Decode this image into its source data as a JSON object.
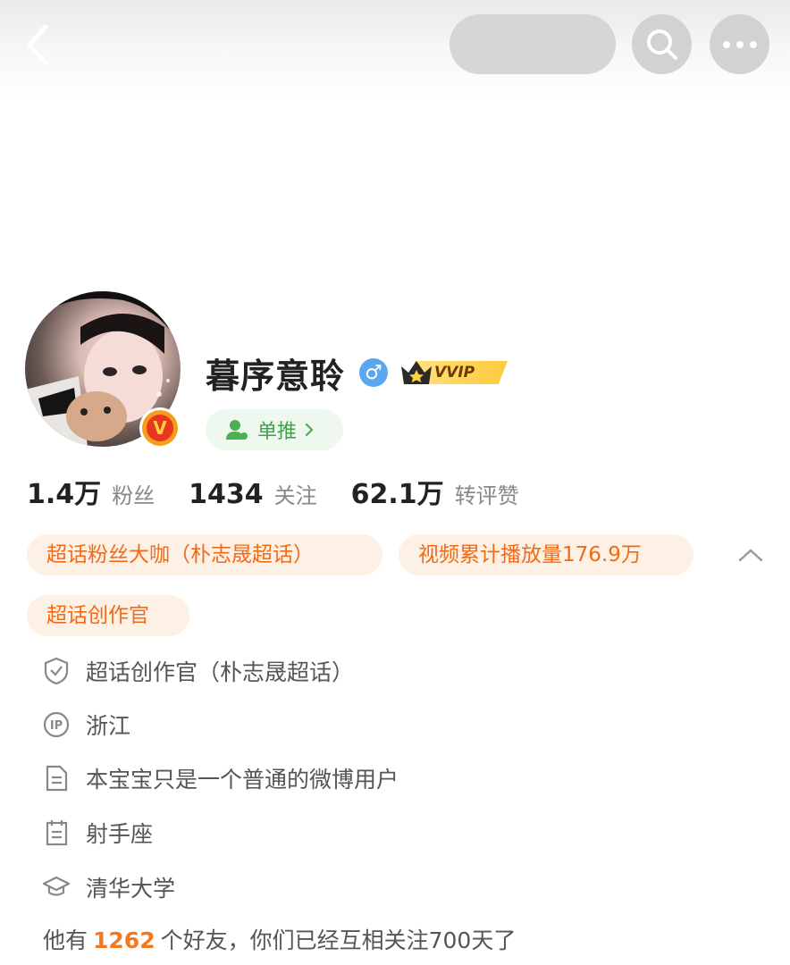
{
  "profile": {
    "username": "暮序意聆",
    "gender_symbol": "♂",
    "vvip_label": "VVIP",
    "verified_symbol": "V",
    "tag_button_label": "单推",
    "stats": [
      {
        "value": "1.4万",
        "label": "粉丝"
      },
      {
        "value": "1434",
        "label": "关注"
      },
      {
        "value": "62.1万",
        "label": "转评赞"
      }
    ],
    "chips": [
      "超话粉丝大咖（朴志晟超话）",
      "视频累计播放量176.9万",
      "超话创作官"
    ],
    "info": [
      {
        "icon": "shield-check-icon",
        "text": "超话创作官（朴志晟超话）"
      },
      {
        "icon": "ip-location-icon",
        "text": "浙江"
      },
      {
        "icon": "document-icon",
        "text": "本宝宝只是一个普通的微博用户"
      },
      {
        "icon": "calendar-icon",
        "text": "射手座"
      },
      {
        "icon": "graduation-cap-icon",
        "text": "清华大学"
      }
    ],
    "friends": {
      "prefix": "他有",
      "count": "1262",
      "suffix": "个好友，你们已经互相关注700天了"
    }
  },
  "colors": {
    "accent_orange": "#f26a16",
    "chip_bg": "#fdf1e6",
    "green": "#3fa148",
    "gender_blue": "#5aa7f0"
  }
}
